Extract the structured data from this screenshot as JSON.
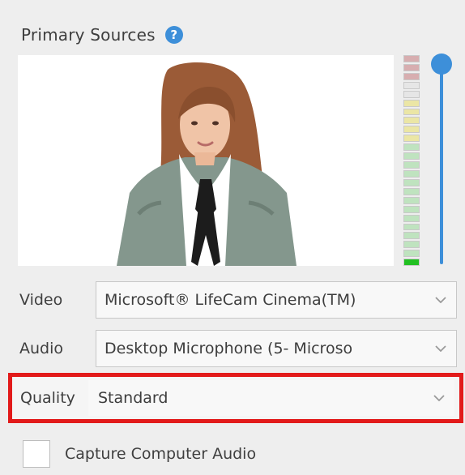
{
  "header": {
    "title": "Primary Sources",
    "help_icon": "question-circle-icon"
  },
  "preview": {
    "subject": "webcam-preview-image"
  },
  "meter": {
    "colors": [
      "#d7aeb0",
      "#d7aeb0",
      "#d7aeb0",
      "#e6e6e6",
      "#e6e6e6",
      "#ebe6a5",
      "#ebe6a5",
      "#ebe6a5",
      "#ebe6a5",
      "#ebe6a5",
      "#bfe3bf",
      "#bfe3bf",
      "#bfe3bf",
      "#bfe3bf",
      "#bfe3bf",
      "#bfe3bf",
      "#bfe3bf",
      "#bfe3bf",
      "#bfe3bf",
      "#bfe3bf",
      "#bfe3bf",
      "#bfe3bf",
      "#bfe3bf",
      "#22c022"
    ]
  },
  "volume": {
    "accent": "#3d8fd9",
    "level_fraction": 1.0
  },
  "rows": {
    "video_label": "Video",
    "video_value": "Microsoft® LifeCam Cinema(TM)",
    "audio_label": "Audio",
    "audio_value": "Desktop Microphone (5- Microso",
    "quality_label": "Quality",
    "quality_value": "Standard",
    "highlight_color": "#e21a1a"
  },
  "capture": {
    "label": "Capture Computer Audio"
  }
}
